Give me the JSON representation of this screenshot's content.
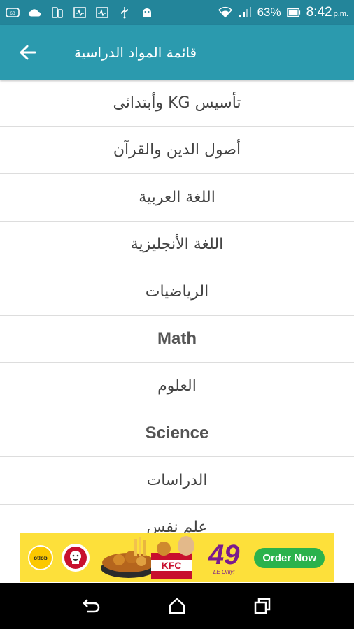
{
  "status_bar": {
    "battery_percent": "63%",
    "time": "8:42",
    "ampm": "p.m."
  },
  "toolbar": {
    "title": "قائمة المواد الدراسية"
  },
  "subjects": [
    {
      "label": "تأسيس KG وأبتدائى"
    },
    {
      "label": "أصول الدين والقرآن"
    },
    {
      "label": "اللغة العربية"
    },
    {
      "label": "اللغة الأنجليزية"
    },
    {
      "label": "الرياضيات"
    },
    {
      "label": "Math"
    },
    {
      "label": "العلوم"
    },
    {
      "label": "Science"
    },
    {
      "label": "الدراسات"
    },
    {
      "label": "علم نفس"
    }
  ],
  "ad": {
    "otlob_text": "otlob",
    "price": "49",
    "price_note": "LE Only!",
    "order_button": "Order Now",
    "kfc_text": "KFC",
    "brand_color": "#7a1b8e",
    "button_color": "#2bb24c"
  },
  "colors": {
    "status_bar": "#23859a",
    "toolbar": "#2b9aae"
  }
}
